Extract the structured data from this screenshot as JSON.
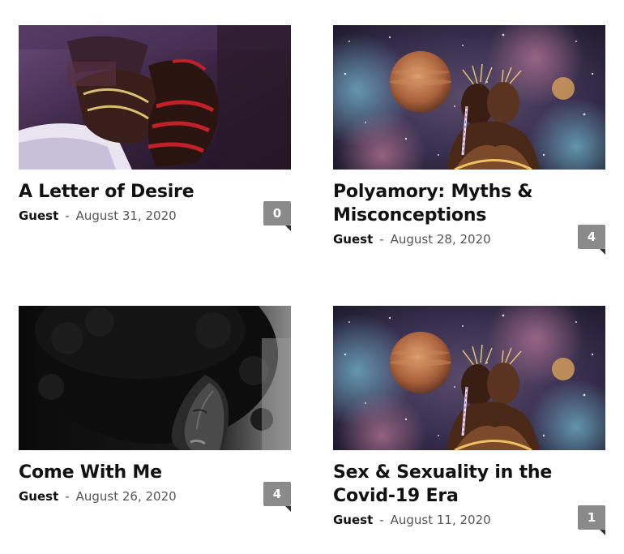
{
  "posts": [
    {
      "title": "A Letter of Desire",
      "author": "Guest",
      "separator": "-",
      "date": "August 31, 2020",
      "comments": "0",
      "image": "bound-figure-illustration"
    },
    {
      "title": "Polyamory: Myths & Misconceptions",
      "author": "Guest",
      "separator": "-",
      "date": "August 28, 2020",
      "comments": "4",
      "image": "cosmic-couple-illustration"
    },
    {
      "title": "Come With Me",
      "author": "Guest",
      "separator": "-",
      "date": "August 26, 2020",
      "comments": "4",
      "image": "afro-woman-photo"
    },
    {
      "title": "Sex & Sexuality in the Covid-19 Era",
      "author": "Guest",
      "separator": "-",
      "date": "August 11, 2020",
      "comments": "1",
      "image": "cosmic-couple-illustration"
    }
  ],
  "colors": {
    "comment_badge": "#8a8a8a",
    "title": "#111111",
    "meta": "#555555"
  }
}
